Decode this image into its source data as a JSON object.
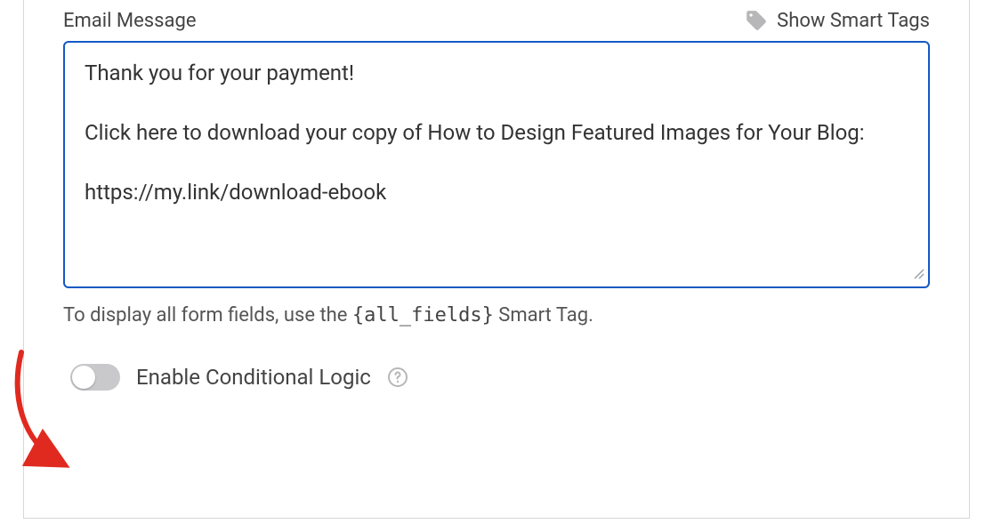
{
  "field_label": "Email Message",
  "smart_tags_link": "Show Smart Tags",
  "textarea_value": "Thank you for your payment!\n\nClick here to download your copy of How to Design Featured Images for Your Blog:\n\nhttps://my.link/download-ebook",
  "hint_prefix": "To display all form fields, use the ",
  "hint_token": "{all_fields}",
  "hint_suffix": " Smart Tag.",
  "toggle_label": "Enable Conditional Logic",
  "toggle_state": false,
  "colors": {
    "focus_border": "#1459c4",
    "annotation": "#e02a1f",
    "icon_muted": "#b7b7b9"
  }
}
